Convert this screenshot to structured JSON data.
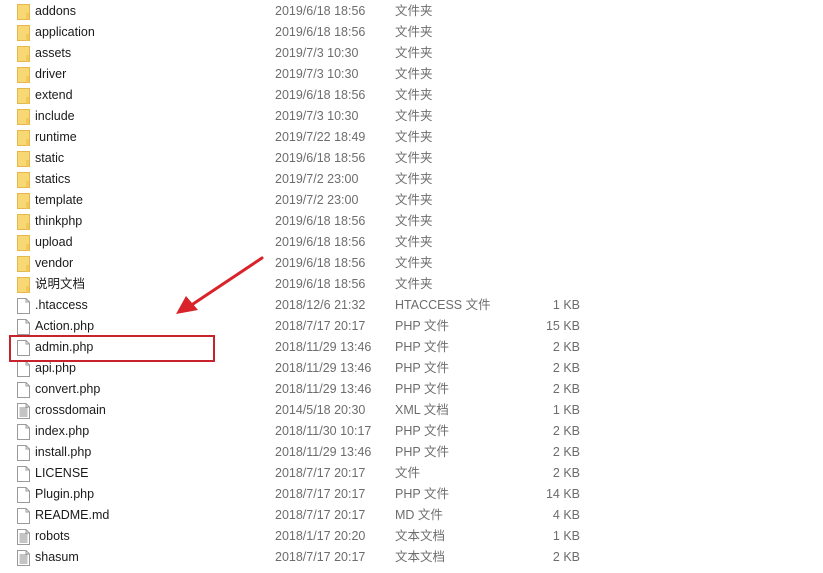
{
  "annotation": {
    "highlight_target": "admin.php",
    "highlight_color": "#c8232c",
    "arrow_color": "#d9232a"
  },
  "colors": {
    "folder": "#f8d775",
    "folder_edge": "#e6b84a",
    "file_edge": "#9a9a9a"
  },
  "files": [
    {
      "name": "addons",
      "date": "2019/6/18 18:56",
      "type": "文件夹",
      "size": "",
      "icon": "folder-icon"
    },
    {
      "name": "application",
      "date": "2019/6/18 18:56",
      "type": "文件夹",
      "size": "",
      "icon": "folder-icon"
    },
    {
      "name": "assets",
      "date": "2019/7/3 10:30",
      "type": "文件夹",
      "size": "",
      "icon": "folder-icon"
    },
    {
      "name": "driver",
      "date": "2019/7/3 10:30",
      "type": "文件夹",
      "size": "",
      "icon": "folder-icon"
    },
    {
      "name": "extend",
      "date": "2019/6/18 18:56",
      "type": "文件夹",
      "size": "",
      "icon": "folder-icon"
    },
    {
      "name": "include",
      "date": "2019/7/3 10:30",
      "type": "文件夹",
      "size": "",
      "icon": "folder-icon"
    },
    {
      "name": "runtime",
      "date": "2019/7/22 18:49",
      "type": "文件夹",
      "size": "",
      "icon": "folder-icon"
    },
    {
      "name": "static",
      "date": "2019/6/18 18:56",
      "type": "文件夹",
      "size": "",
      "icon": "folder-icon"
    },
    {
      "name": "statics",
      "date": "2019/7/2 23:00",
      "type": "文件夹",
      "size": "",
      "icon": "folder-icon"
    },
    {
      "name": "template",
      "date": "2019/7/2 23:00",
      "type": "文件夹",
      "size": "",
      "icon": "folder-icon"
    },
    {
      "name": "thinkphp",
      "date": "2019/6/18 18:56",
      "type": "文件夹",
      "size": "",
      "icon": "folder-icon"
    },
    {
      "name": "upload",
      "date": "2019/6/18 18:56",
      "type": "文件夹",
      "size": "",
      "icon": "folder-icon"
    },
    {
      "name": "vendor",
      "date": "2019/6/18 18:56",
      "type": "文件夹",
      "size": "",
      "icon": "folder-icon"
    },
    {
      "name": "说明文档",
      "date": "2019/6/18 18:56",
      "type": "文件夹",
      "size": "",
      "icon": "folder-icon"
    },
    {
      "name": ".htaccess",
      "date": "2018/12/6 21:32",
      "type": "HTACCESS 文件",
      "size": "1 KB",
      "icon": "file-icon"
    },
    {
      "name": "Action.php",
      "date": "2018/7/17 20:17",
      "type": "PHP 文件",
      "size": "15 KB",
      "icon": "file-icon"
    },
    {
      "name": "admin.php",
      "date": "2018/11/29 13:46",
      "type": "PHP 文件",
      "size": "2 KB",
      "icon": "file-icon"
    },
    {
      "name": "api.php",
      "date": "2018/11/29 13:46",
      "type": "PHP 文件",
      "size": "2 KB",
      "icon": "file-icon"
    },
    {
      "name": "convert.php",
      "date": "2018/11/29 13:46",
      "type": "PHP 文件",
      "size": "2 KB",
      "icon": "file-icon"
    },
    {
      "name": "crossdomain",
      "date": "2014/5/18 20:30",
      "type": "XML 文档",
      "size": "1 KB",
      "icon": "text-document-icon"
    },
    {
      "name": "index.php",
      "date": "2018/11/30 10:17",
      "type": "PHP 文件",
      "size": "2 KB",
      "icon": "file-icon"
    },
    {
      "name": "install.php",
      "date": "2018/11/29 13:46",
      "type": "PHP 文件",
      "size": "2 KB",
      "icon": "file-icon"
    },
    {
      "name": "LICENSE",
      "date": "2018/7/17 20:17",
      "type": "文件",
      "size": "2 KB",
      "icon": "file-icon"
    },
    {
      "name": "Plugin.php",
      "date": "2018/7/17 20:17",
      "type": "PHP 文件",
      "size": "14 KB",
      "icon": "file-icon"
    },
    {
      "name": "README.md",
      "date": "2018/7/17 20:17",
      "type": "MD 文件",
      "size": "4 KB",
      "icon": "file-icon"
    },
    {
      "name": "robots",
      "date": "2018/1/17 20:20",
      "type": "文本文档",
      "size": "1 KB",
      "icon": "text-document-icon"
    },
    {
      "name": "shasum",
      "date": "2018/7/17 20:17",
      "type": "文本文档",
      "size": "2 KB",
      "icon": "text-document-icon"
    }
  ]
}
